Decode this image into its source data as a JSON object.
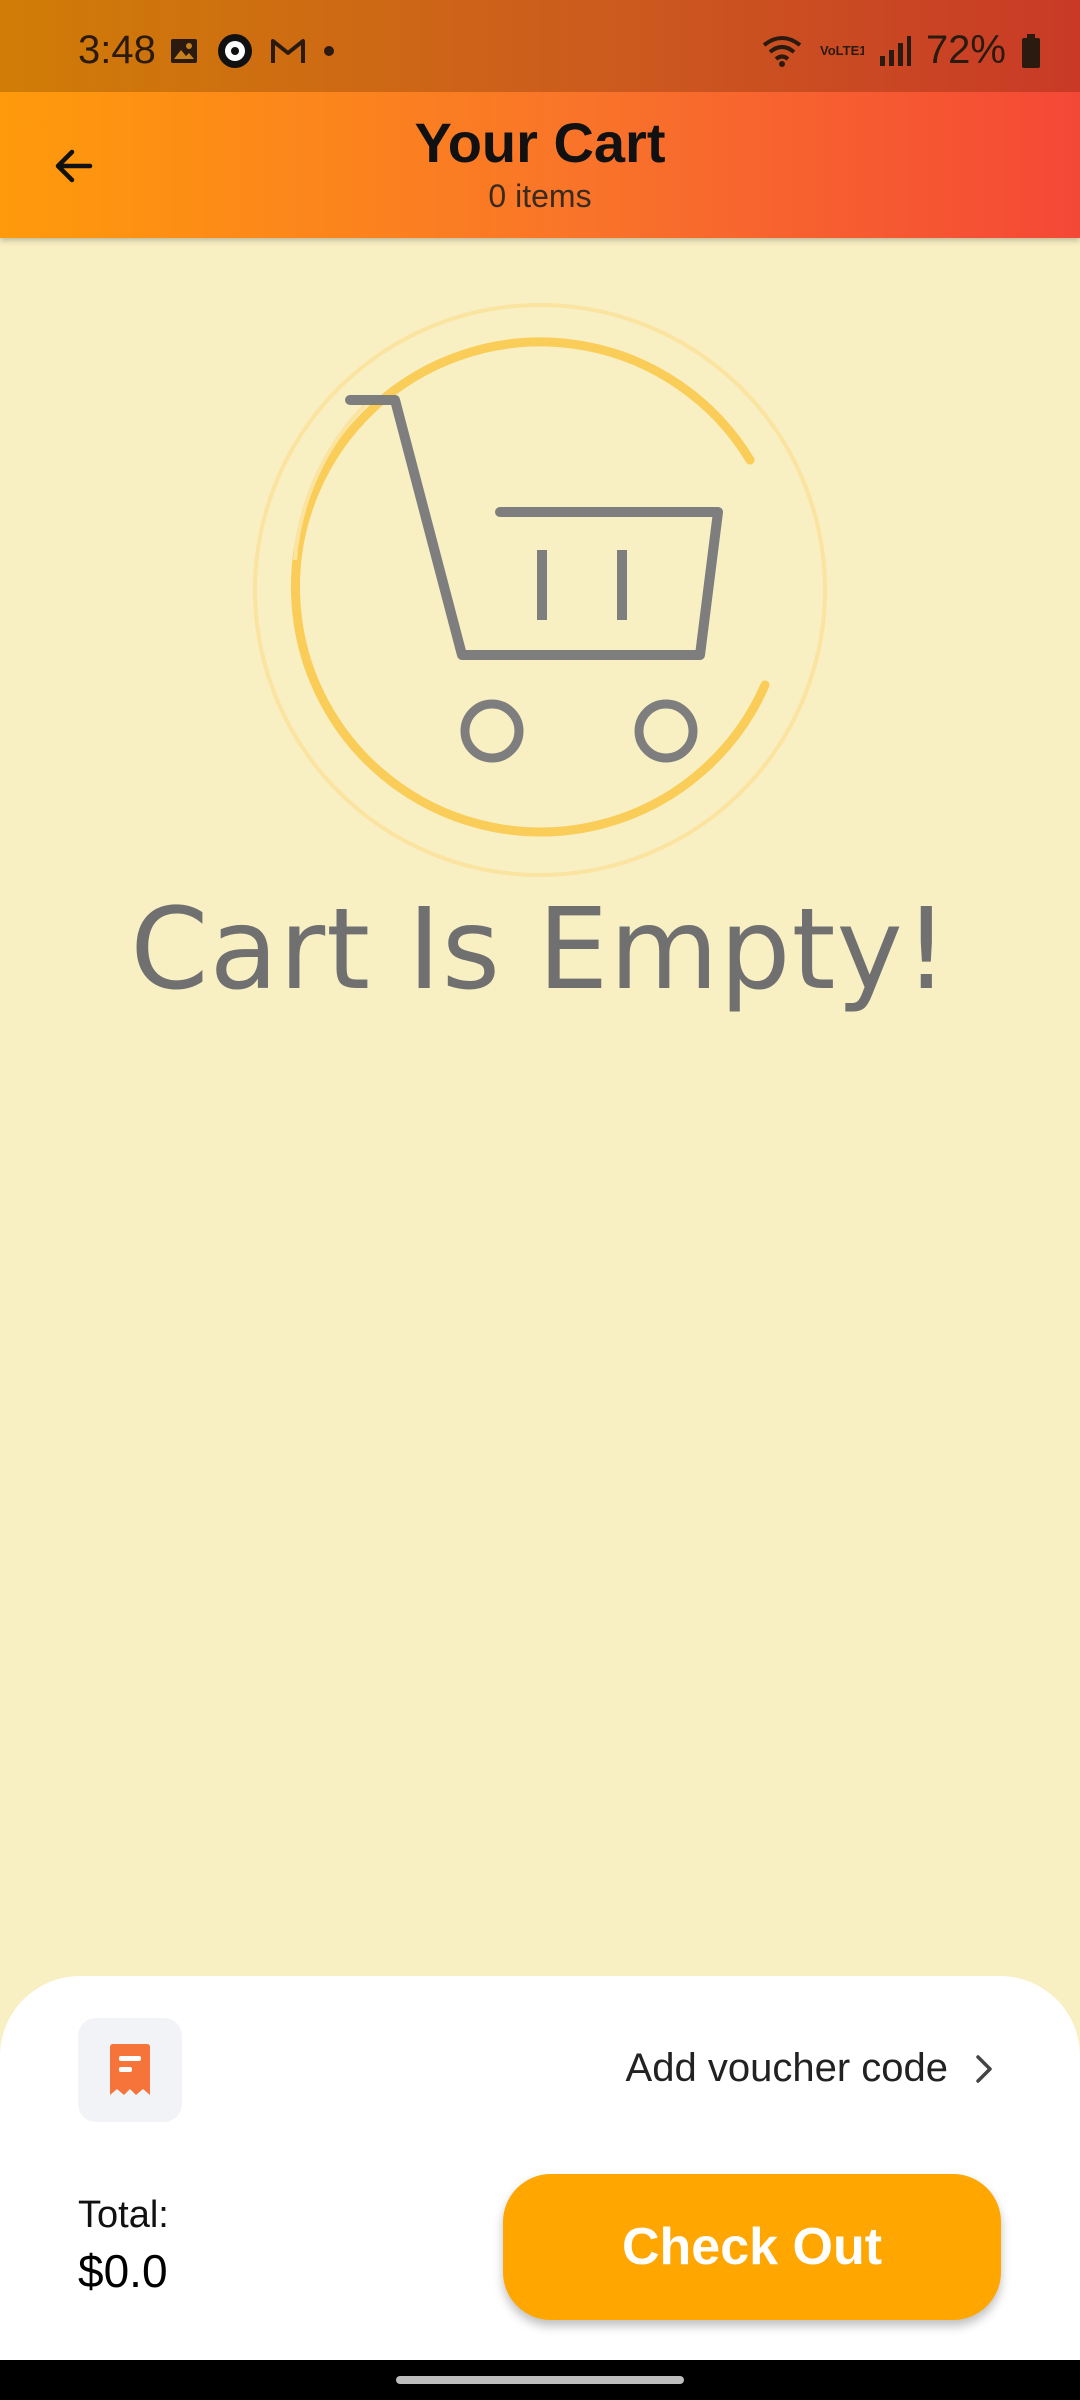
{
  "status_bar": {
    "time": "3:48",
    "battery": "72%",
    "icons_left": [
      "image-icon",
      "app-icon",
      "gmail-icon",
      "dot-icon"
    ],
    "icons_right": [
      "wifi-icon",
      "volte-icon",
      "signal-icon",
      "battery-icon"
    ],
    "volte_label": "VoLTE1"
  },
  "header": {
    "title": "Your Cart",
    "subtitle": "0 items",
    "back_icon": "arrow-left-icon"
  },
  "empty_state": {
    "message": "Cart Is Empty!",
    "illustration_icon": "cart-icon"
  },
  "footer": {
    "voucher_label": "Add voucher code",
    "voucher_icon": "receipt-icon",
    "total_label": "Total:",
    "total_value": "$0.0",
    "checkout_label": "Check Out"
  },
  "colors": {
    "header_gradient": [
      "#ff9a0b",
      "#f44836"
    ],
    "background": "#f8efc3",
    "checkout_button": "#ffa600",
    "voucher_icon": "#f6743a"
  }
}
